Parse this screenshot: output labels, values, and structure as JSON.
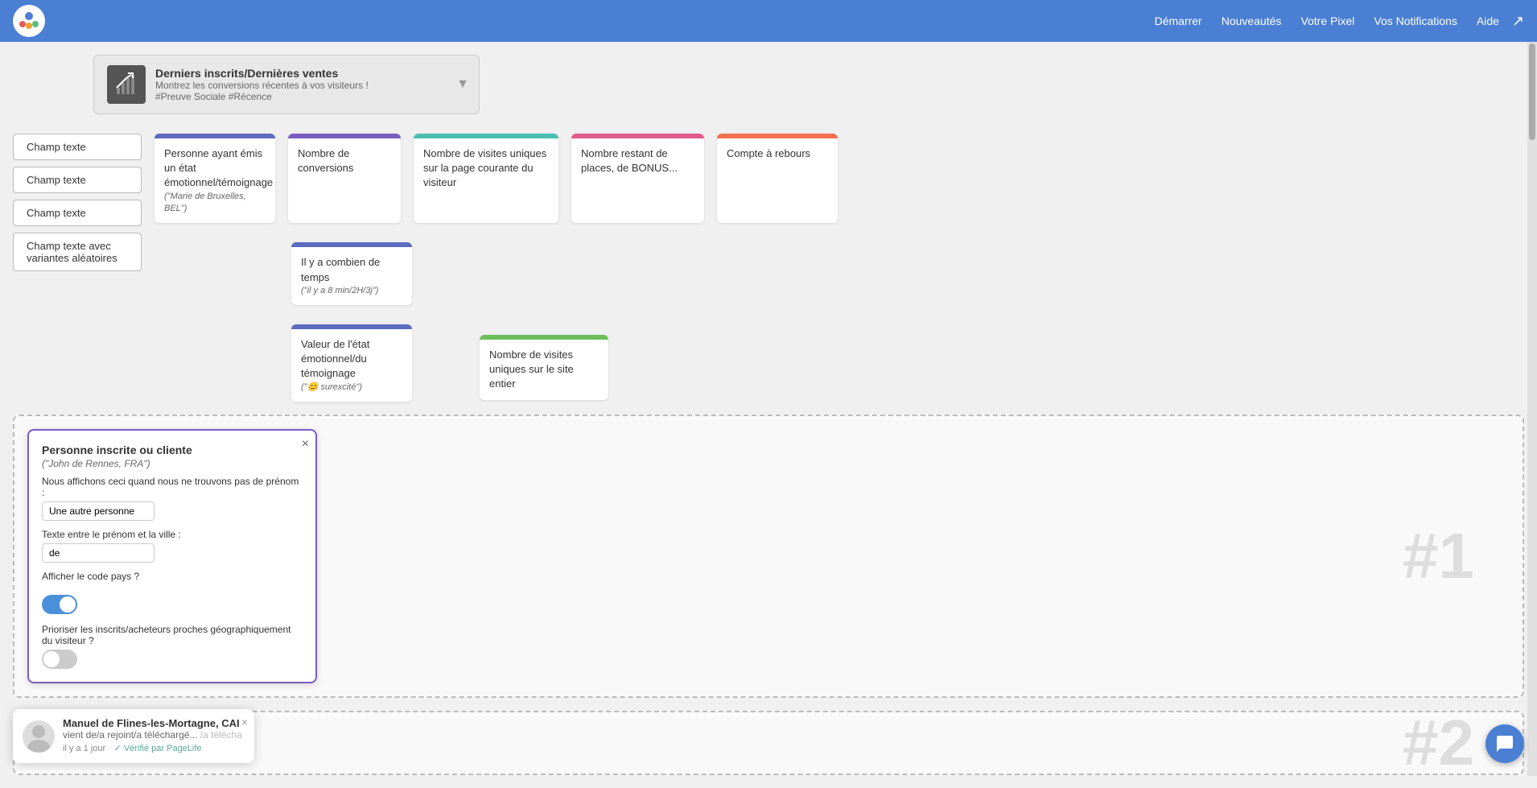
{
  "header": {
    "nav_items": [
      "Démarrer",
      "Nouveautés",
      "Votre Pixel",
      "Vos Notifications",
      "Aide"
    ],
    "export_icon": "↗"
  },
  "banner": {
    "title": "Derniers inscrits/Dernières ventes",
    "subtitle": "Montrez les conversions récentes à vos visiteurs !",
    "tags": "#Preuve Sociale #Récence"
  },
  "text_fields": [
    "Champ texte",
    "Champ texte",
    "Champ texte",
    "Champ texte avec variantes aléatoires"
  ],
  "blocks": [
    {
      "label": "Personne ayant émis un état émotionnel/témoignage",
      "subtitle": "(\"Marie de Bruxelles, BEL\")",
      "color": "blue"
    },
    {
      "label": "Nombre de conversions",
      "subtitle": "",
      "color": "purple"
    },
    {
      "label": "Nombre de visites uniques sur la page courante du visiteur",
      "subtitle": "",
      "color": "teal"
    },
    {
      "label": "Nombre restant de places, de BONUS...",
      "subtitle": "",
      "color": "pink"
    },
    {
      "label": "Compte à rebours",
      "subtitle": "",
      "color": "orange"
    },
    {
      "label": "Il y a combien de temps",
      "subtitle": "(\"il y a 8 min/2H/3j\")",
      "color": "blue"
    },
    {
      "label": "Valeur de l'état émotionnel/du témoignage",
      "subtitle": "(\"😊 surexcité\")",
      "color": "blue"
    },
    {
      "label": "Nombre de visites uniques sur le site entier",
      "subtitle": "",
      "color": "green"
    }
  ],
  "popup": {
    "title": "Personne inscrite ou cliente",
    "subtitle": "(\"John de Rennes, FRA\")",
    "fallback_label": "Nous affichons ceci quand nous ne trouvons pas de prénom :",
    "fallback_value": "Une autre personne",
    "between_label": "Texte entre le prénom et la ville :",
    "between_value": "de",
    "country_code_label": "Afficher le code pays ?",
    "country_code_on": true,
    "geo_label": "Prioriser les inscrits/acheteurs proches géographiquement du visiteur ?",
    "geo_on": false,
    "close": "×"
  },
  "dashed_areas": {
    "watermark_1": "#1",
    "watermark_2": "#2"
  },
  "toast": {
    "name": "Manuel de Flines-les-Mortagne, CAI",
    "action": "vient de/a rejoint/a téléchargé...",
    "truncated": "/a télécha",
    "time": "il y a 1 jour",
    "verified": "✓ Vérifié par PageLife",
    "close": "×"
  }
}
